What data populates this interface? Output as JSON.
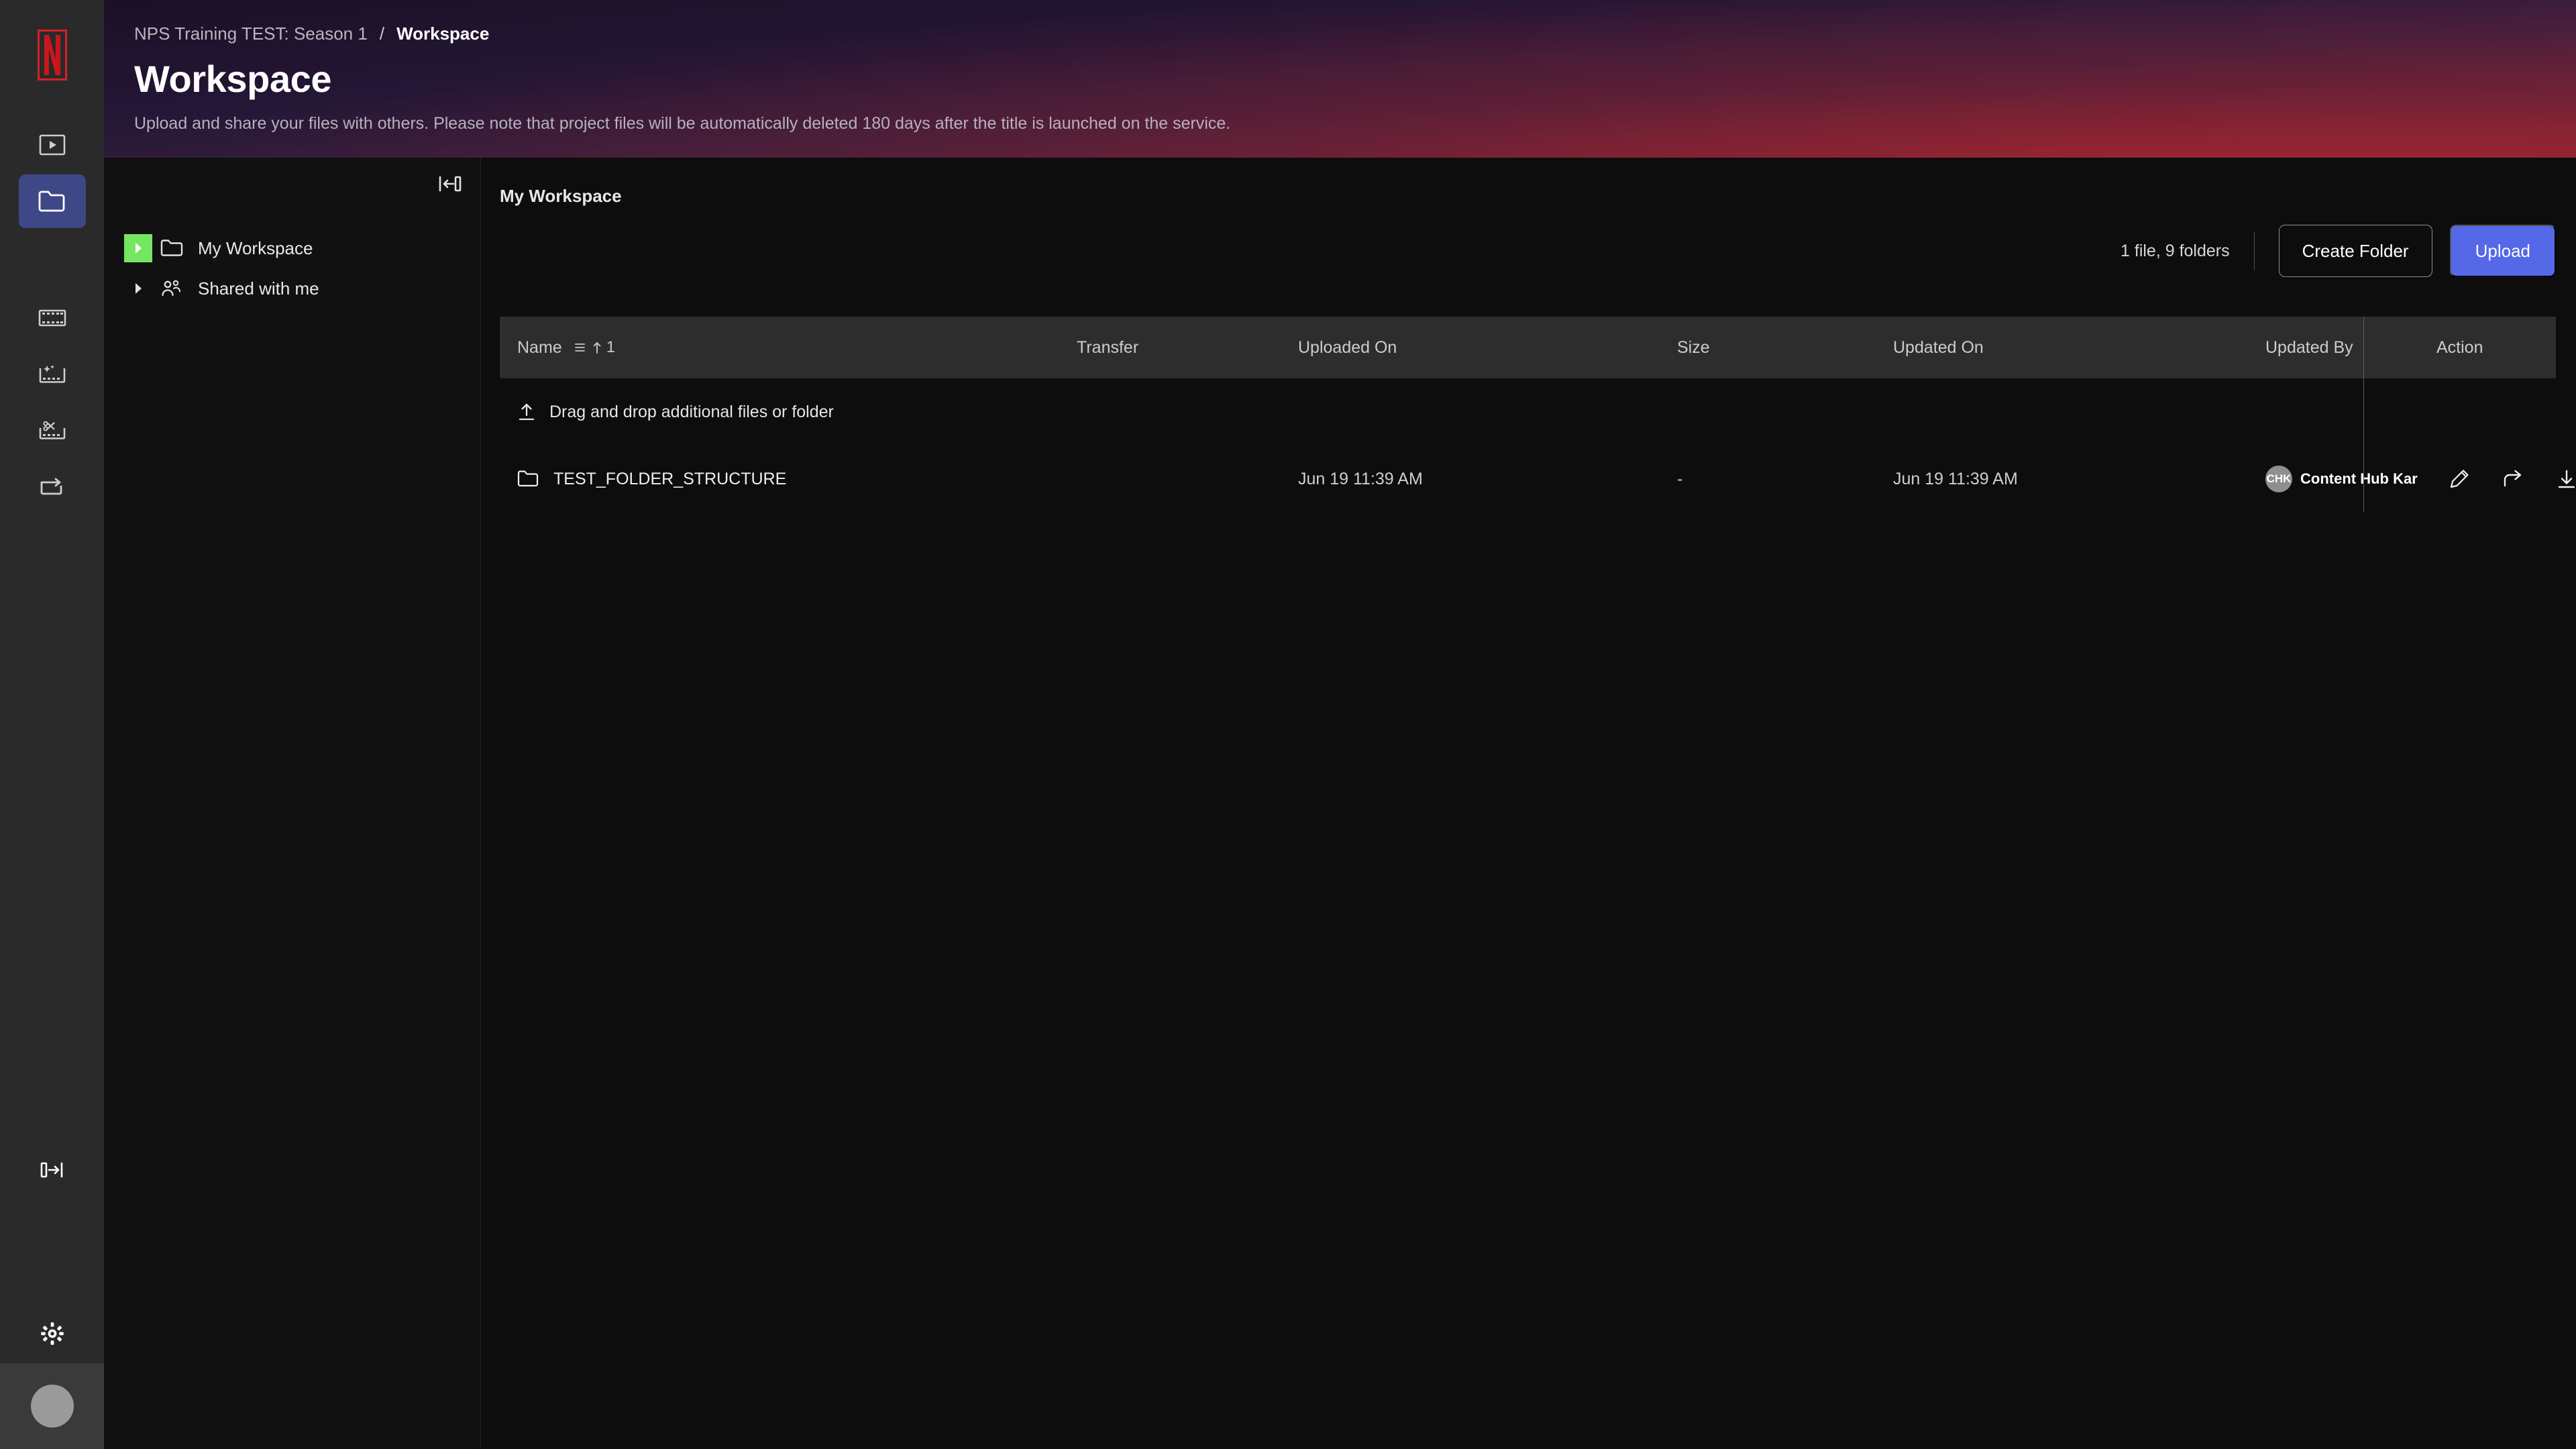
{
  "brand": {
    "logo": "netflix-n-logo",
    "logo_color": "#d81f26"
  },
  "rail": {
    "items": [
      {
        "name": "player-icon",
        "label": "Player"
      },
      {
        "name": "folder-icon",
        "label": "Workspace",
        "active": true
      },
      {
        "name": "film-strip-icon",
        "label": "Media"
      },
      {
        "name": "film-strip-sparkle-icon",
        "label": "Enhance"
      },
      {
        "name": "film-strip-scissors-icon",
        "label": "Edit"
      },
      {
        "name": "transfer-arrow-icon",
        "label": "Transfer"
      }
    ],
    "expand_icon": "expand-sidebar-icon",
    "settings_icon": "gear-icon",
    "avatar": "user-avatar"
  },
  "header": {
    "breadcrumb_parent": "NPS Training TEST: Season 1",
    "breadcrumb_separator": "/",
    "breadcrumb_current": "Workspace",
    "title": "Workspace",
    "subtitle": "Upload and share your files with others. Please note that project files will be automatically deleted 180 days after the title is launched on the service.",
    "gradient_from": "#1b1026",
    "gradient_to": "#7e2b3a"
  },
  "tree": {
    "collapse_icon": "collapse-panel-icon",
    "items": [
      {
        "caret": "caret-right-icon",
        "icon": "folder-icon",
        "label": "My Workspace",
        "highlighted": true
      },
      {
        "caret": "caret-right-icon",
        "icon": "shared-users-icon",
        "label": "Shared with me",
        "highlighted": false
      }
    ],
    "highlight_color": "#76e662"
  },
  "main": {
    "breadcrumb": "My Workspace",
    "count_text": "1 file, 9 folders",
    "create_folder_label": "Create Folder",
    "upload_label": "Upload",
    "upload_color": "#5468e8",
    "drop_hint": "Drag and drop additional files or folder",
    "drop_icon": "upload-icon",
    "columns": {
      "name": "Name",
      "sort_indicator": "1",
      "transfer": "Transfer",
      "uploaded_on": "Uploaded On",
      "size": "Size",
      "updated_on": "Updated On",
      "updated_by": "Updated By",
      "action": "Action"
    },
    "rows": [
      {
        "icon": "folder-icon",
        "name": "TEST_FOLDER_STRUCTURE",
        "transfer": "",
        "uploaded_on": "Jun 19 11:39 AM",
        "size": "-",
        "updated_on": "Jun 19 11:39 AM",
        "updated_by_initials": "CHK",
        "updated_by_name": "Content Hub Kar",
        "actions": [
          "pencil-icon",
          "share-arrow-icon",
          "download-icon",
          "more-vertical-icon"
        ]
      }
    ]
  }
}
